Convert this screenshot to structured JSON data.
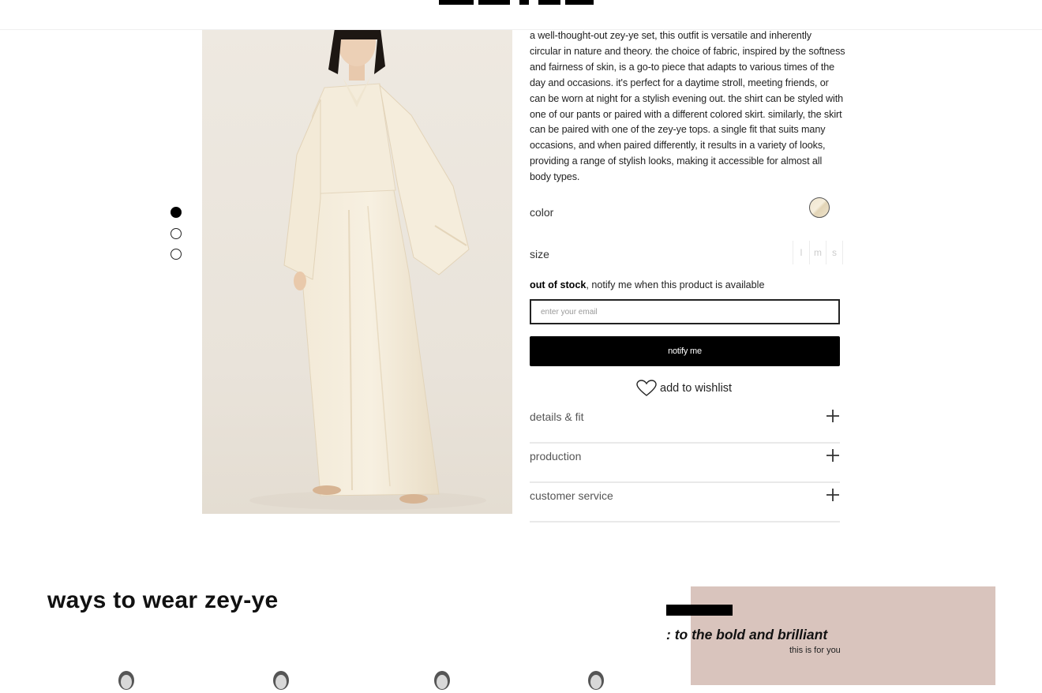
{
  "brand": {
    "logo_text": "zey-ye"
  },
  "gallery": {
    "image_count": 3,
    "active_index": 0,
    "photo_alt": "model wearing cream zey-ye shirt and wide skirt set"
  },
  "product": {
    "description": "a well-thought-out zey-ye set, this outfit is versatile and inherently circular in nature and theory. the choice of fabric, inspired by the softness and fairness of skin, is a go-to piece that adapts to various times of the day and occasions. it's perfect for a daytime stroll, meeting friends, or can be worn at night for a stylish evening out. the shirt can be styled with one of our pants or paired with a different colored skirt. similarly, the skirt can be paired with one of the zey-ye tops. a single fit that suits many occasions, and when paired differently, it results in a variety of looks, providing a range of stylish looks, making it accessible for almost all body types.",
    "color_label": "color",
    "color_swatch": "#efe4cc",
    "size_label": "size",
    "sizes": [
      "l",
      "m",
      "s"
    ],
    "stock_bold": "out of stock",
    "stock_rest": ", notify me when this product is available",
    "email_placeholder": "enter your email",
    "notify_label": "notify me",
    "wishlist_label": "add to wishlist",
    "accordion": [
      "details & fit",
      "production",
      "customer service"
    ]
  },
  "ways": {
    "title": "ways to wear zey-ye"
  },
  "promo": {
    "title": ": to the bold and brilliant",
    "subtitle": "this is for you",
    "bg_color": "#d9c4bd"
  }
}
